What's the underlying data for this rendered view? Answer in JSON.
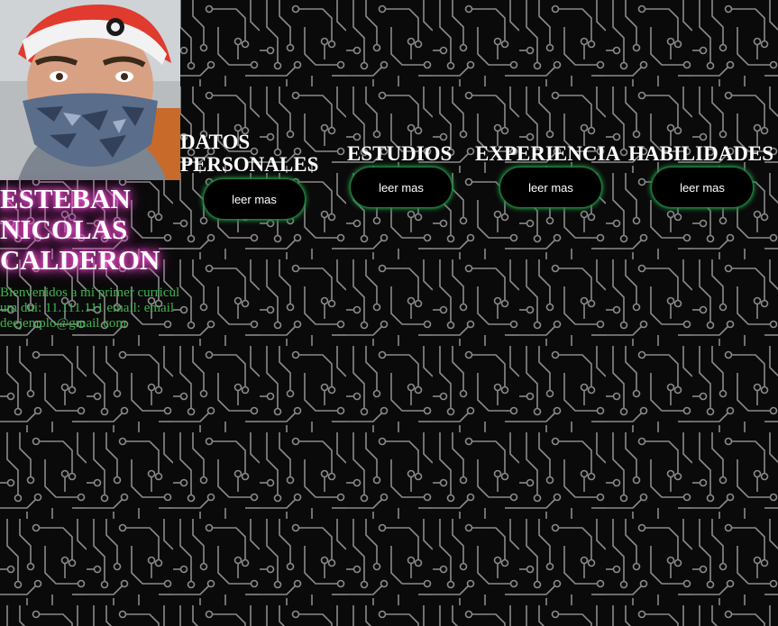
{
  "profile": {
    "name_line1": "ESTEBAN",
    "name_line2": "NICOLAS",
    "name_line3": "CALDERON",
    "intro_text": "Bienvenidos a mi primer curriculum dni: 11.111.111 email: emaildeejemplo@gmail.com"
  },
  "sections": [
    {
      "title_line1": "DATOS",
      "title_line2": "PERSONALES",
      "button_label": "leer mas"
    },
    {
      "title": "ESTUDIOS",
      "button_label": "leer mas"
    },
    {
      "title": "EXPERIENCIA",
      "button_label": "leer mas"
    },
    {
      "title": "HABILIDADES",
      "button_label": "leer mas"
    }
  ],
  "colors": {
    "background": "#0a0a0a",
    "circuit_lines": "#8a8a8a",
    "name_glow": "#ff4fd8",
    "intro_text": "#3fb34f",
    "button_glow": "#1f7a3a"
  }
}
